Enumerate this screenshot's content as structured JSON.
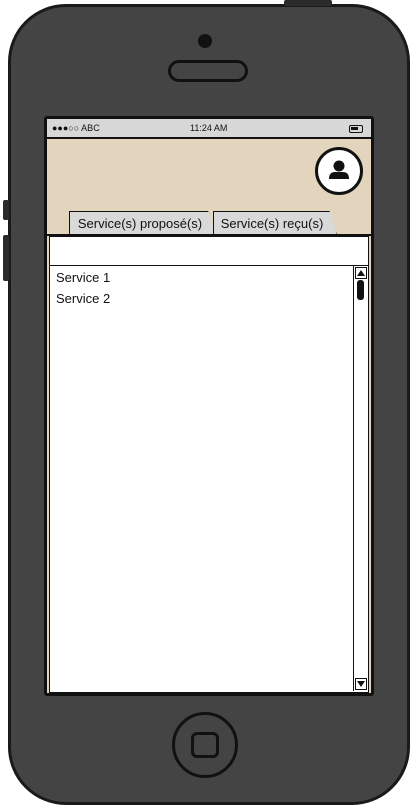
{
  "status_bar": {
    "carrier": "●●●○○ ABC",
    "time": "11:24 AM"
  },
  "header": {
    "profile_icon": "user-avatar-icon"
  },
  "tabs": [
    {
      "label": "Service(s) proposé(s)"
    },
    {
      "label": "Service(s) reçu(s)"
    }
  ],
  "filter": {
    "value": ""
  },
  "list": {
    "items": [
      "Service 1",
      "Service 2"
    ]
  },
  "colors": {
    "header_bg": "#e3d4bd",
    "phone_body": "#444444",
    "tab_bg": "#d9d9d9"
  }
}
